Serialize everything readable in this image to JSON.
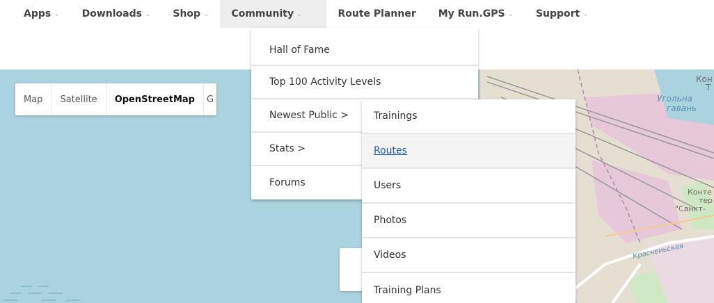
{
  "nav": {
    "items": [
      {
        "label": "Apps",
        "chevron": "⌄"
      },
      {
        "label": "Downloads",
        "chevron": "⌄"
      },
      {
        "label": "Shop",
        "chevron": "⌄"
      },
      {
        "label": "Community",
        "chevron": "⌄",
        "active": true
      },
      {
        "label": "Route Planner",
        "chevron": ""
      },
      {
        "label": "My Run.GPS",
        "chevron": "⌄"
      },
      {
        "label": "Support",
        "chevron": "⌄"
      }
    ]
  },
  "community_menu": {
    "items": [
      {
        "label": "Hall of Fame"
      },
      {
        "label": "Top 100 Activity Levels"
      },
      {
        "label": "Newest Public >"
      },
      {
        "label": "Stats >"
      },
      {
        "label": "Forums"
      }
    ]
  },
  "newest_public_submenu": {
    "items": [
      {
        "label": "Trainings"
      },
      {
        "label": "Routes",
        "hovered": true
      },
      {
        "label": "Users"
      },
      {
        "label": "Photos"
      },
      {
        "label": "Videos"
      },
      {
        "label": "Training Plans"
      }
    ]
  },
  "map": {
    "type_buttons": [
      {
        "label": "Map"
      },
      {
        "label": "Satellite"
      },
      {
        "label": "OpenStreetMap",
        "active": true
      },
      {
        "label": "G"
      }
    ],
    "labels": {
      "l1": "Кон",
      "l2": "Т",
      "l3": "Угольна",
      "l4": "гавань",
      "l5": "Конте",
      "l6": "тер",
      "l7": "\"Санкт-",
      "l8": "Краснеиьская"
    }
  },
  "colors": {
    "water": "#aad3df",
    "land": "#e5dfd2",
    "industrial": "#e6c8d8",
    "link": "#1a5fb4"
  }
}
